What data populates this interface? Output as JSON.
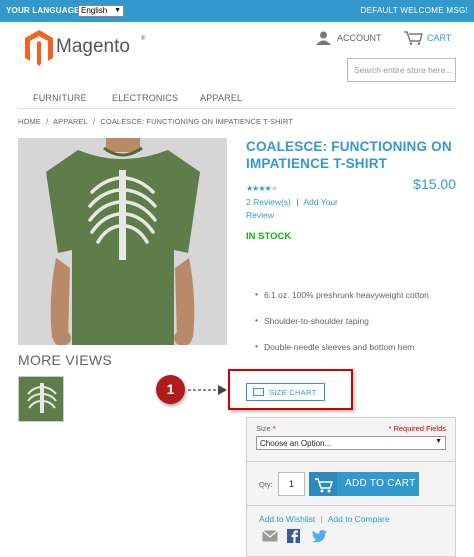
{
  "topbar": {
    "language_label": "YOUR LANGUAGE:",
    "language_value": "English",
    "welcome": "DEFAULT WELCOME MSG!",
    "bg_color": "#3399cc"
  },
  "header": {
    "logo_text": "Magento",
    "logo_mark": "®",
    "account_label": "ACCOUNT",
    "cart_label": "CART",
    "search_placeholder": "Search entire store here..."
  },
  "nav": {
    "items": [
      {
        "label": "FURNITURE"
      },
      {
        "label": "ELECTRONICS"
      },
      {
        "label": "APPAREL"
      }
    ]
  },
  "breadcrumb": {
    "items": [
      "HOME",
      "/",
      "APPAREL",
      "/",
      "COALESCE: FUNCTIONING ON IMPATIENCE T-SHIRT"
    ]
  },
  "gallery": {
    "more_views_label": "MORE VIEWS"
  },
  "product": {
    "title": "COALESCE: FUNCTIONING ON IMPATIENCE T-SHIRT",
    "rating_filled": 4,
    "rating_max": 5,
    "price": "$15.00",
    "reviews_link": "2 Review(s)",
    "review_sep": "|",
    "add_review_link": "Add Your Review",
    "stock": "IN STOCK",
    "features": [
      "6.1 oz. 100% preshrunk heavyweight cotton",
      "Shoulder-to-shoulder taping",
      "Double-needle sleeves and bottom hem"
    ],
    "size_chart_label": "SIZE CHART"
  },
  "annotation": {
    "number": "1",
    "color": "#d10000"
  },
  "options": {
    "size_label": "Size",
    "required_mark": "*",
    "required_note": "* Required Fields",
    "size_select_value": "Choose an Option...",
    "qty_label": "Qty:",
    "qty_value": "1",
    "add_to_cart_label": "ADD TO CART",
    "wishlist_link": "Add to Wishlist",
    "links_sep": "|",
    "compare_link": "Add to Compare",
    "social_icons": [
      "email-icon",
      "facebook-icon",
      "twitter-icon"
    ]
  },
  "colors": {
    "accent": "#3399cc",
    "stock": "#11b400",
    "required": "#d10000"
  }
}
